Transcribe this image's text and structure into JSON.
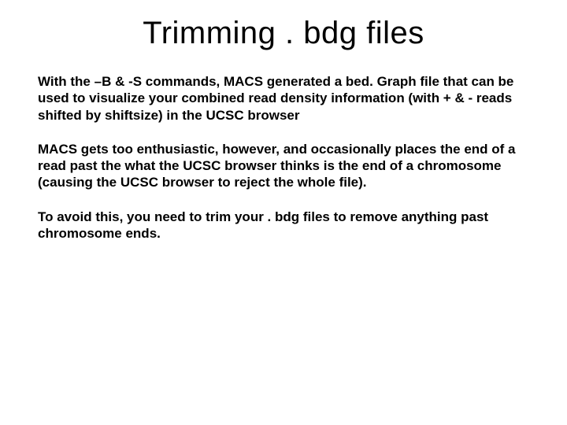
{
  "title": "Trimming . bdg files",
  "paragraphs": {
    "p1": "With the –B & -S commands, MACS generated a bed. Graph file that can be used to visualize your combined read density information (with + & - reads shifted by shiftsize) in the UCSC browser",
    "p2": "MACS gets too enthusiastic, however, and occasionally places the end of a read past the what the UCSC browser thinks is the end of a chromosome (causing the UCSC browser to reject the whole file).",
    "p3": "To avoid this, you need to trim your . bdg files to remove anything past chromosome ends."
  }
}
